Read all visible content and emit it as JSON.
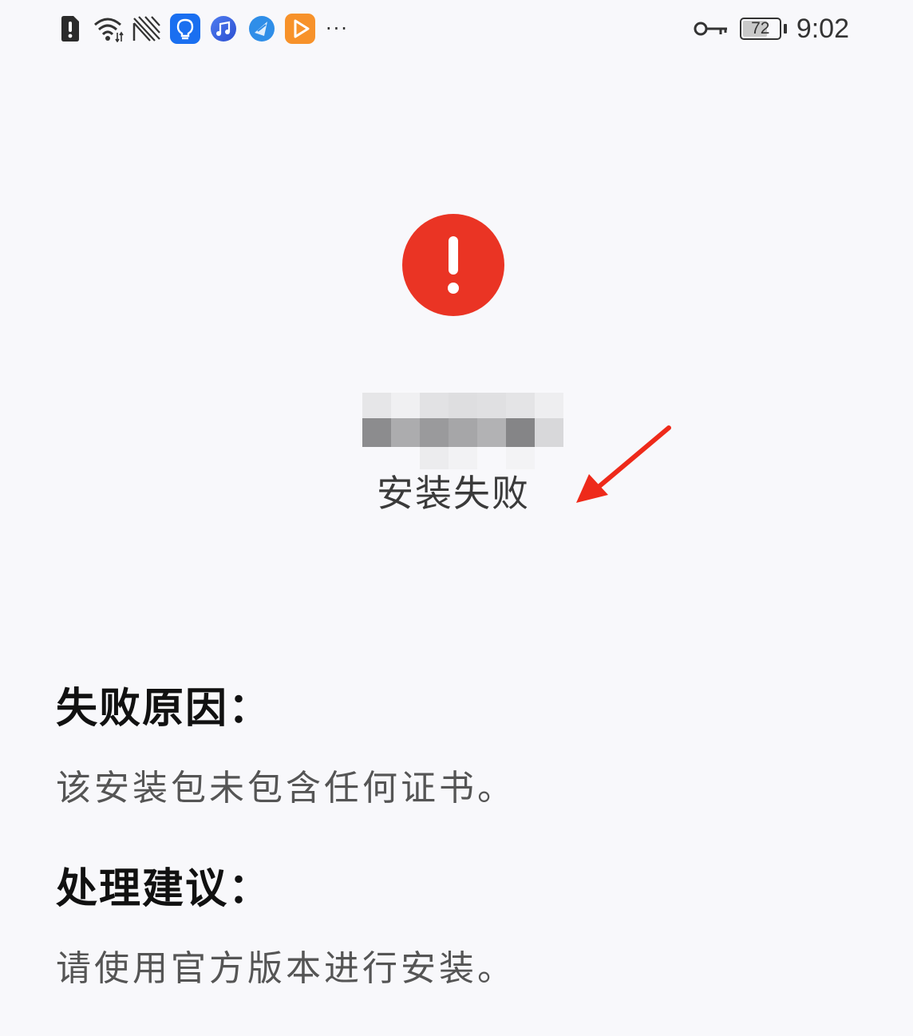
{
  "status_bar": {
    "left_icons": [
      "sim-alert-icon",
      "wifi-icon",
      "signal-icon",
      "tips-app-icon",
      "music-app-icon",
      "browser-app-icon",
      "video-app-icon"
    ],
    "more_indicator": "···",
    "vpn_icon": "key-icon",
    "battery_level": "72",
    "battery_percent": 72,
    "time": "9:02"
  },
  "result": {
    "icon": "error-exclamation-icon",
    "icon_color": "#ea3424",
    "app_name_redacted": true,
    "title": "安装失败"
  },
  "annotation": {
    "arrow_color": "#ee2a1a"
  },
  "sections": {
    "reason": {
      "heading": "失败原因：",
      "text": "该安装包未包含任何证书。"
    },
    "advice": {
      "heading": "处理建议：",
      "text": "请使用官方版本进行安装。"
    }
  }
}
